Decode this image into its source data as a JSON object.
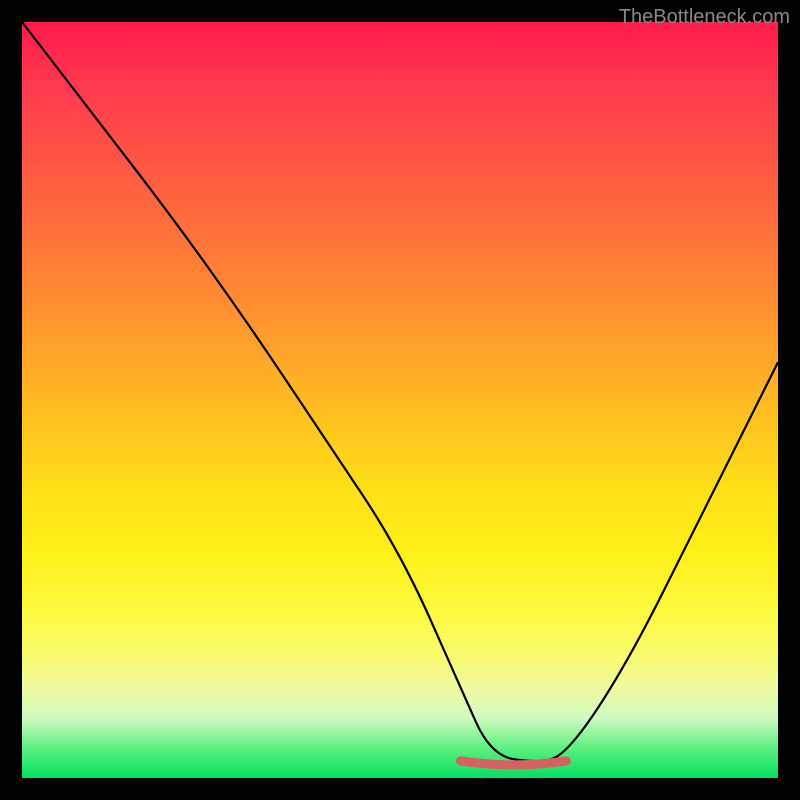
{
  "watermark": "TheBottleneck.com",
  "chart_data": {
    "type": "line",
    "title": "",
    "xlabel": "",
    "ylabel": "",
    "xlim": [
      0,
      100
    ],
    "ylim": [
      0,
      100
    ],
    "series": [
      {
        "name": "curve",
        "x": [
          0,
          10,
          20,
          30,
          40,
          50,
          58,
          62,
          68,
          72,
          80,
          90,
          100
        ],
        "values": [
          100,
          87,
          74,
          60,
          45,
          30,
          12,
          3,
          2,
          3,
          15,
          35,
          55
        ]
      }
    ],
    "marker": {
      "name": "bottleneck-range",
      "x_start": 58,
      "x_end": 72,
      "y": 2,
      "color": "#d86060"
    },
    "gradient_stops": [
      {
        "pos": 0,
        "color": "#ff1a4a"
      },
      {
        "pos": 50,
        "color": "#ffd020"
      },
      {
        "pos": 85,
        "color": "#fbfb80"
      },
      {
        "pos": 100,
        "color": "#00e060"
      }
    ]
  }
}
